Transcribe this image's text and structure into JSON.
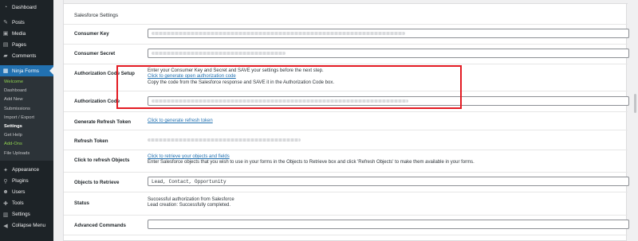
{
  "sidebar": {
    "top_items": [
      {
        "label": "Dashboard",
        "icon": "dashboard-icon"
      },
      {
        "label": "Posts",
        "icon": "pin-icon"
      },
      {
        "label": "Media",
        "icon": "media-icon"
      },
      {
        "label": "Pages",
        "icon": "pages-icon"
      },
      {
        "label": "Comments",
        "icon": "comments-icon"
      }
    ],
    "current": {
      "label": "Ninja Forms",
      "icon": "ninja-forms-icon"
    },
    "submenu": [
      "Welcome",
      "Dashboard",
      "Add New",
      "Submissions",
      "Import / Export",
      "Settings",
      "Get Help",
      "Add-Ons",
      "File Uploads"
    ],
    "bottom_items": [
      {
        "label": "Appearance",
        "icon": "appearance-icon"
      },
      {
        "label": "Plugins",
        "icon": "plugins-icon"
      },
      {
        "label": "Users",
        "icon": "users-icon"
      },
      {
        "label": "Tools",
        "icon": "tools-icon"
      },
      {
        "label": "Settings",
        "icon": "settings-icon"
      },
      {
        "label": "Collapse Menu",
        "icon": "collapse-icon"
      }
    ]
  },
  "section": {
    "title": "Salesforce Settings"
  },
  "rows": {
    "consumer_key": {
      "label": "Consumer Key"
    },
    "consumer_secret": {
      "label": "Consumer Secret"
    },
    "auth_setup": {
      "label": "Authorization Code Setup",
      "line1": "Enter your Consumer Key and Secret and SAVE your settings before the next step.",
      "link": "Click to generate open authorization code",
      "line2": "Copy the code from the Salesforce response and SAVE it in the Authorization Code box."
    },
    "auth_code": {
      "label": "Authorization Code"
    },
    "refresh_token_gen": {
      "label": "Generate Refresh Token",
      "link": "Click to generate refresh token"
    },
    "refresh_token": {
      "label": "Refresh Token"
    },
    "refresh_objects": {
      "label": "Click to refresh Objects",
      "link": "Click to retrieve your objects and fields",
      "desc": "Enter Salesforce objects that you wish to use in your forms in the Objects to Retrieve box and click 'Refresh Objects' to make them available in your forms."
    },
    "objects_to_retrieve": {
      "label": "Objects to Retrieve",
      "value": "Lead, Contact, Opportunity"
    },
    "status": {
      "label": "Status",
      "line1": "Successful authorization from Salesforce",
      "line2": "Lead creation: Successfully completed."
    },
    "advanced": {
      "label": "Advanced Commands"
    }
  },
  "colors": {
    "highlight": "#e31b23",
    "accent": "#2271b1",
    "sidebar": "#1d2327"
  }
}
